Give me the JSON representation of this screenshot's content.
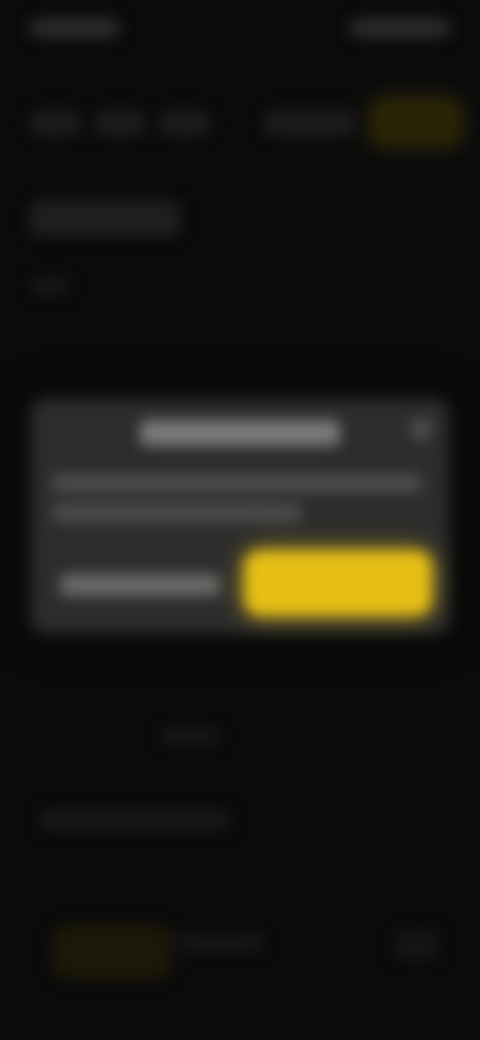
{
  "status_bar": {},
  "nav": {},
  "dialog": {},
  "colors": {
    "background": "#0b0b0b",
    "dialog": "#2c2c2c",
    "accent": "#e6bf16"
  }
}
